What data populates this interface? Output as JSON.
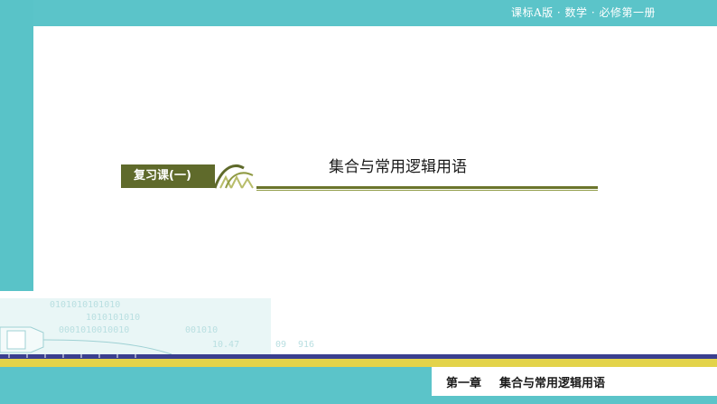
{
  "header": {
    "course_tag": "课标A版 · 数学 · 必修第一册"
  },
  "title_block": {
    "badge": "复习课(一)",
    "title": "集合与常用逻辑用语"
  },
  "footer": {
    "chapter": "第一章",
    "chapter_title": "集合与常用逻辑用语"
  },
  "colors": {
    "teal": "#5bc4c9",
    "olive": "#5f6a2b",
    "yellow": "#e3d34a"
  },
  "decor": {
    "binary_texts": [
      "0101010101010",
      "1010101010",
      "0001010010010",
      "001010",
      "10.47",
      "09",
      "916"
    ]
  }
}
